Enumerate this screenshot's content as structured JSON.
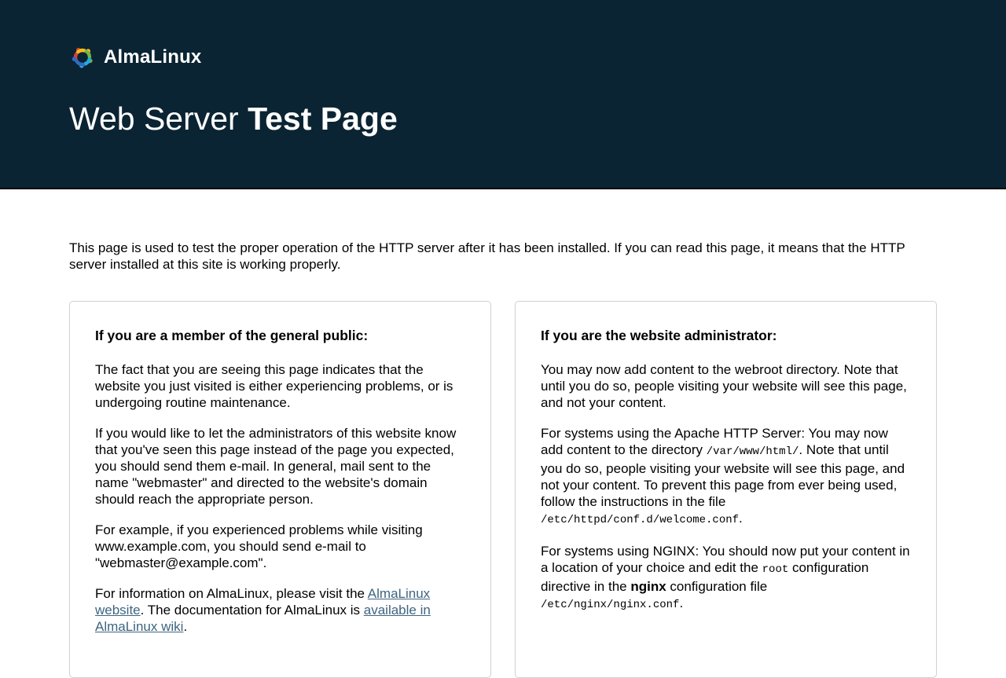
{
  "colors": {
    "header_bg": "#0b2433",
    "header_border": "#000000",
    "title_text": "#ffffff",
    "body_text": "#000000",
    "link": "#3e6580",
    "card_border": "#d0d0d0"
  },
  "header": {
    "logo_text": "AlmaLinux",
    "logo_icon": "almalinux-swirl",
    "logo_colors": [
      "#d6432f",
      "#f7bd1e",
      "#73b643",
      "#27a9e0",
      "#2e6cc4"
    ],
    "title_regular": "Web Server ",
    "title_bold": "Test Page"
  },
  "intro": "This page is used to test the proper operation of the HTTP server after it has been installed. If you can read this page, it means that the HTTP server installed at this site is working properly.",
  "cards": [
    {
      "heading": "If you are a member of the general public:",
      "paragraphs": [
        {
          "segments": [
            {
              "t": "text",
              "s": "The fact that you are seeing this page indicates that the website you just visited is either experiencing problems, or is undergoing routine maintenance."
            }
          ]
        },
        {
          "segments": [
            {
              "t": "text",
              "s": "If you would like to let the administrators of this website know that you've seen this page instead of the page you expected, you should send them e-mail. In general, mail sent to the name \"webmaster\" and directed to the website's domain should reach the appropriate person."
            }
          ]
        },
        {
          "segments": [
            {
              "t": "text",
              "s": "For example, if you experienced problems while visiting www.example.com, you should send e-mail to \"webmaster@example.com\"."
            }
          ]
        },
        {
          "segments": [
            {
              "t": "text",
              "s": "For information on AlmaLinux, please visit the "
            },
            {
              "t": "link",
              "s": "AlmaLinux website",
              "name": "almalinux-website-link"
            },
            {
              "t": "text",
              "s": ". The documentation for AlmaLinux is "
            },
            {
              "t": "link",
              "s": "available in AlmaLinux wiki",
              "name": "almalinux-wiki-link"
            },
            {
              "t": "text",
              "s": "."
            }
          ]
        }
      ]
    },
    {
      "heading": "If you are the website administrator:",
      "paragraphs": [
        {
          "segments": [
            {
              "t": "text",
              "s": "You may now add content to the webroot directory. Note that until you do so, people visiting your website will see this page, and not your content."
            }
          ]
        },
        {
          "segments": [
            {
              "t": "text",
              "s": "For systems using the Apache HTTP Server: You may now add content to the directory "
            },
            {
              "t": "mono",
              "s": "/var/www/html/"
            },
            {
              "t": "text",
              "s": ". Note that until you do so, people visiting your website will see this page, and not your content. To prevent this page from ever being used, follow the instructions in the file "
            },
            {
              "t": "mono",
              "s": "/etc/httpd/conf.d/welcome.conf"
            },
            {
              "t": "text",
              "s": "."
            }
          ]
        },
        {
          "segments": [
            {
              "t": "text",
              "s": "For systems using NGINX: You should now put your content in a location of your choice and edit the "
            },
            {
              "t": "mono",
              "s": "root"
            },
            {
              "t": "text",
              "s": " configuration directive in the "
            },
            {
              "t": "bold",
              "s": "nginx"
            },
            {
              "t": "text",
              "s": " configuration file "
            },
            {
              "t": "mono",
              "s": "/etc/nginx/nginx.conf"
            },
            {
              "t": "text",
              "s": "."
            }
          ]
        }
      ]
    }
  ]
}
